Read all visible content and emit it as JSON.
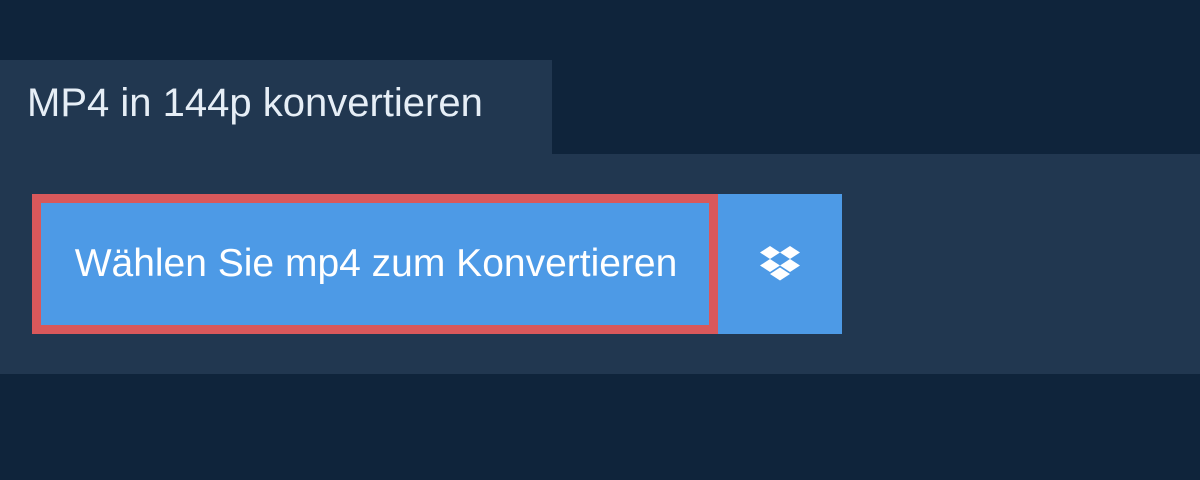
{
  "header": {
    "title": "MP4 in 144p konvertieren"
  },
  "upload": {
    "choose_label": "Wählen Sie mp4 zum Konvertieren",
    "dropbox_icon": "dropbox-icon"
  },
  "colors": {
    "background": "#0f243b",
    "panel": "#213750",
    "button": "#4d9ae6",
    "button_border": "#d9585b",
    "text": "#ffffff"
  }
}
